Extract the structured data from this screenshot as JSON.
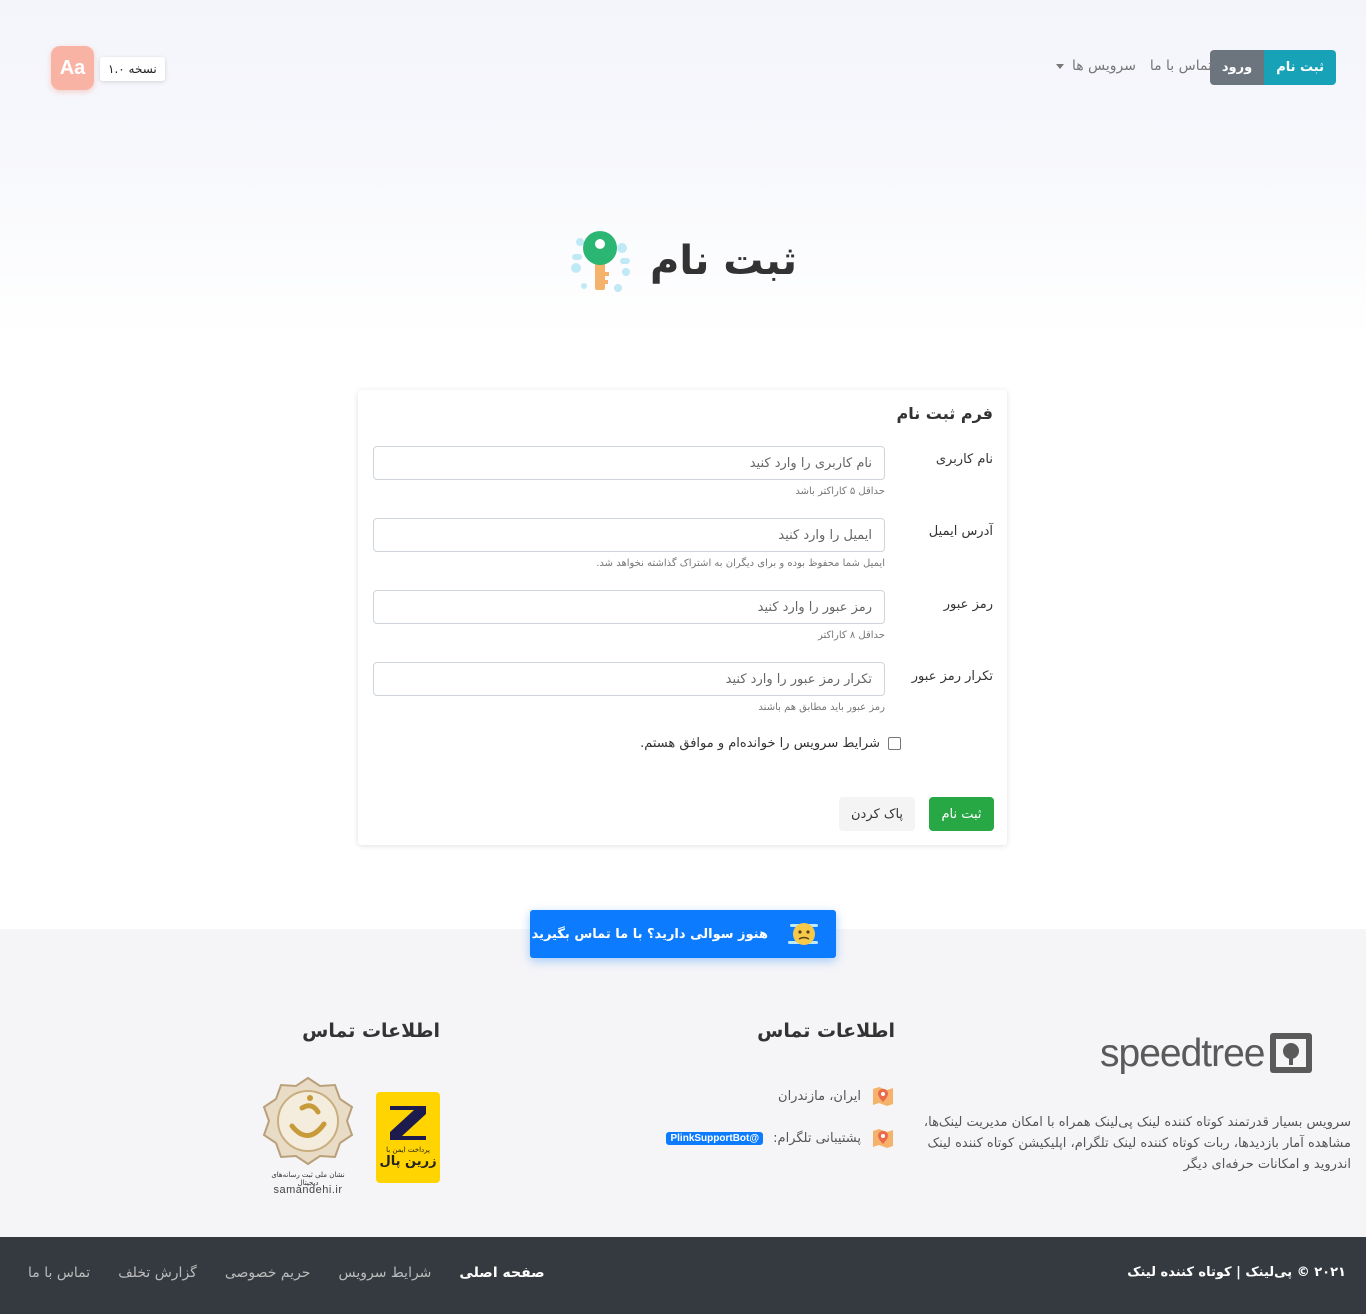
{
  "nav": {
    "register_button": "ثبت نام",
    "login_button": "ورود",
    "contact_link": "تماس با ما",
    "services_link": "سرویس ها",
    "version_label": "نسخه ۱.۰",
    "logo_text": "Aa"
  },
  "page": {
    "title": "ثبت نام",
    "icon": "key-icon"
  },
  "form": {
    "title": "فرم ثبت نام",
    "fields": [
      {
        "label": "نام کاربری",
        "placeholder": "نام کاربری را وارد کنید",
        "hint": "حداقل ۵ کاراکتر باشد"
      },
      {
        "label": "آدرس ایمیل",
        "placeholder": "ایمیل را وارد کنید",
        "hint": "ایمیل شما محفوظ بوده و برای دیگران به اشتراک گذاشته نخواهد شد."
      },
      {
        "label": "رمز عبور",
        "placeholder": "رمز عبور را وارد کنید",
        "hint": "حداقل ۸ کاراکتر"
      },
      {
        "label": "تکرار رمز عبور",
        "placeholder": "تکرار رمز عبور را وارد کنید",
        "hint": "رمز عبور باید مطابق هم باشند"
      }
    ],
    "terms_label": "شرایط سرویس را خوانده‌ام و موافق هستم.",
    "submit_button": "ثبت نام",
    "clear_button": "پاک کردن"
  },
  "cta": {
    "label": "هنوز سوالی دارید؟ با ما تماس بگیرید"
  },
  "footer": {
    "brand": "speedtree",
    "about": "سرویس بسیار قدرتمند کوتاه کننده لینک پی‌لینک همراه با امکان مدیریت لینک‌ها، مشاهده آمار بازدیدها، ربات کوتاه کننده لینک تلگرام، اپلیکیشن کوتاه کننده لینک اندروید و امکانات حرفه‌ای دیگر",
    "contact_heading": "اطلاعات تماس",
    "location": "ایران، مازندران",
    "telegram_label": "پشتیبانی تلگرام:",
    "telegram_handle": "@PlinkSupportBot",
    "badges_heading": "اطلاعات تماس",
    "zarinpal_top": "پرداخت ایمن با",
    "zarinpal_name": "زرین پال",
    "samandehi_sub": "نشان ملی ثبت رسانه‌های دیجیتال",
    "samandehi_url": "samandehi.ir"
  },
  "bottom_bar": {
    "copyright": "۲۰۲۱ © پی‌لینک | کوتاه کننده لینک",
    "links": [
      "صفحه اصلی",
      "شرایط سرویس",
      "حریم خصوصی",
      "گزارش تخلف",
      "تماس با ما"
    ]
  },
  "colors": {
    "accent_register": "#17a2b8",
    "login_gray": "#6c757d",
    "submit_green": "#28a745",
    "cta_blue": "#0d7bfd",
    "bottom_bar": "#343a40"
  }
}
